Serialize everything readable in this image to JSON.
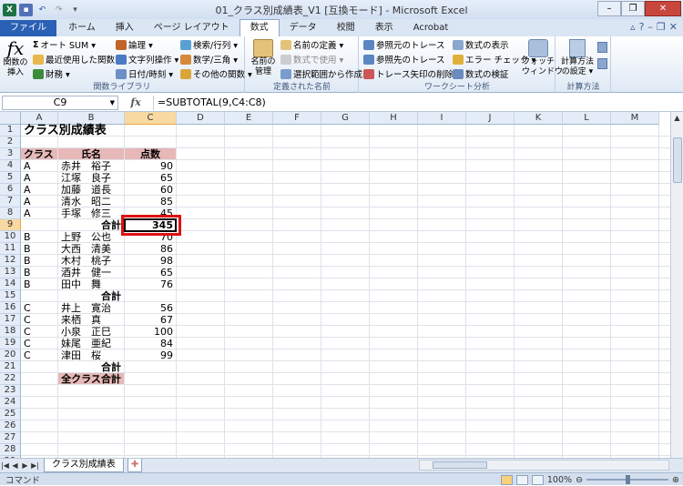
{
  "window": {
    "title": "01_クラス別成績表_V1 [互換モード] - Microsoft Excel",
    "minimize": "–",
    "restore": "❐",
    "close": "✕"
  },
  "qat": {
    "icons": [
      "excel-logo-icon",
      "save-icon",
      "undo-icon",
      "redo-icon",
      "customize-icon"
    ]
  },
  "tabs": [
    {
      "label": "ファイル"
    },
    {
      "label": "ホーム"
    },
    {
      "label": "挿入"
    },
    {
      "label": "ページ レイアウト"
    },
    {
      "label": "数式"
    },
    {
      "label": "データ"
    },
    {
      "label": "校閲"
    },
    {
      "label": "表示"
    },
    {
      "label": "Acrobat"
    }
  ],
  "active_tab": "数式",
  "ribbon": {
    "library": {
      "insert_fn": "関数の\n挿入",
      "autosum": "オート SUM ▾",
      "recent": "最近使用した関数 ▾",
      "financial": "財務 ▾",
      "logical": "論理 ▾",
      "text": "文字列操作 ▾",
      "datetime": "日付/時刻 ▾",
      "lookup": "検索/行列 ▾",
      "math": "数学/三角 ▾",
      "more": "その他の関数 ▾",
      "label": "関数ライブラリ"
    },
    "names": {
      "manager": "名前の\n管理",
      "define": "名前の定義 ▾",
      "use": "数式で使用 ▾",
      "create": "選択範囲から作成",
      "label": "定義された名前"
    },
    "audit": {
      "precedents": "参照元のトレース",
      "dependents": "参照先のトレース",
      "remove": "トレース矢印の削除 ▾",
      "show": "数式の表示",
      "error": "エラー チェック ▾",
      "evaluate": "数式の検証",
      "watch": "ウォッチ\nウィンドウ",
      "label": "ワークシート分析"
    },
    "calc": {
      "options": "計算方法\nの設定 ▾",
      "label": "計算方法"
    }
  },
  "formula_bar": {
    "name_box": "C9",
    "fx": "fx",
    "formula": "=SUBTOTAL(9,C4:C8)"
  },
  "columns": [
    "A",
    "B",
    "C",
    "D",
    "E",
    "F",
    "G",
    "H",
    "I",
    "J",
    "K",
    "L",
    "M"
  ],
  "rows": [
    "1",
    "2",
    "3",
    "4",
    "5",
    "6",
    "7",
    "8",
    "9",
    "10",
    "11",
    "12",
    "13",
    "14",
    "15",
    "16",
    "17",
    "18",
    "19",
    "20",
    "21",
    "22",
    "23",
    "24",
    "25",
    "26",
    "27",
    "28",
    "29"
  ],
  "cells": {
    "a1": "クラス別成績表",
    "a3": "クラス",
    "b3": "氏名",
    "c3": "点数",
    "a4": "A",
    "b4": "赤井　裕子",
    "c4": "90",
    "a5": "A",
    "b5": "江塚　良子",
    "c5": "65",
    "a6": "A",
    "b6": "加藤　道長",
    "c6": "60",
    "a7": "A",
    "b7": "清水　昭二",
    "c7": "85",
    "a8": "A",
    "b8": "手塚　修三",
    "c8": "45",
    "b9": "合計",
    "c9": "345",
    "a10": "B",
    "b10": "上野　公也",
    "c10": "70",
    "a11": "B",
    "b11": "大西　清美",
    "c11": "86",
    "a12": "B",
    "b12": "木村　桃子",
    "c12": "98",
    "a13": "B",
    "b13": "酒井　健一",
    "c13": "65",
    "a14": "B",
    "b14": "田中　舞",
    "c14": "76",
    "b15": "合計",
    "a16": "C",
    "b16": "井上　寛治",
    "c16": "56",
    "a17": "C",
    "b17": "来栖　真",
    "c17": "67",
    "a18": "C",
    "b18": "小泉　正巳",
    "c18": "100",
    "a19": "C",
    "b19": "妹尾　亜紀",
    "c19": "84",
    "a20": "C",
    "b20": "津田　桜",
    "c20": "99",
    "b21": "合計",
    "b22": "全クラス合計"
  },
  "sheet_tabs": {
    "active": "クラス別成績表"
  },
  "status": {
    "mode": "コマンド",
    "zoom": "100%",
    "minus": "⊖",
    "plus": "⊕"
  },
  "colors": {
    "header_fill": "#e6b8b7",
    "highlight": "#dd1111",
    "file_tab": "#2a61b4"
  }
}
